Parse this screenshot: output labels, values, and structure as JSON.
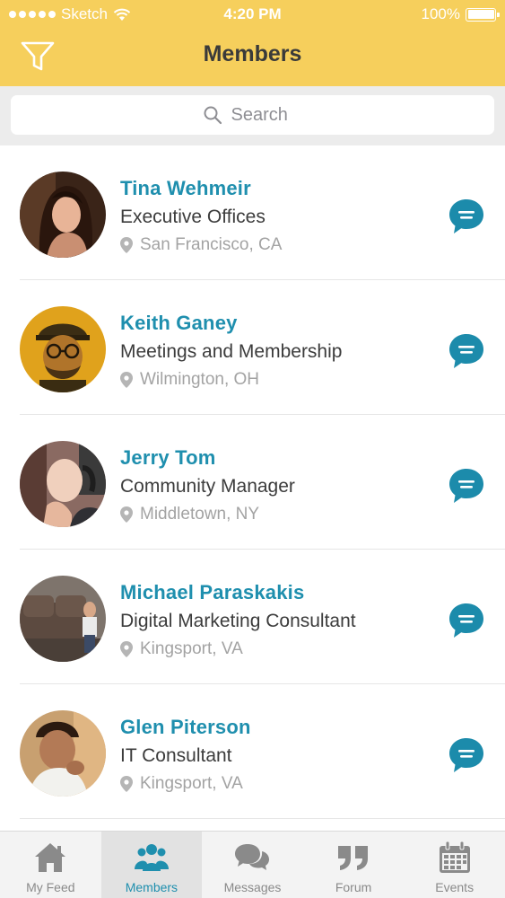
{
  "status_bar": {
    "carrier": "Sketch",
    "time": "4:20 PM",
    "battery": "100%"
  },
  "header": {
    "title": "Members"
  },
  "search": {
    "placeholder": "Search"
  },
  "members": [
    {
      "name": "Tina Wehmeir",
      "department": "Executive Offices",
      "location": "San Francisco, CA"
    },
    {
      "name": "Keith Ganey",
      "department": "Meetings and Membership",
      "location": "Wilmington, OH"
    },
    {
      "name": "Jerry Tom",
      "department": "Community Manager",
      "location": "Middletown, NY"
    },
    {
      "name": "Michael Paraskakis",
      "department": "Digital Marketing Consultant",
      "location": "Kingsport, VA"
    },
    {
      "name": "Glen Piterson",
      "department": "IT Consultant",
      "location": "Kingsport, VA"
    }
  ],
  "tabs": [
    {
      "label": "My Feed",
      "icon": "home-icon"
    },
    {
      "label": "Members",
      "icon": "members-icon",
      "active": true
    },
    {
      "label": "Messages",
      "icon": "chat-bubbles-icon"
    },
    {
      "label": "Forum",
      "icon": "quote-icon"
    },
    {
      "label": "Events",
      "icon": "calendar-icon"
    }
  ],
  "colors": {
    "header": "#f6cf5c",
    "accent": "#1f8fae",
    "chat_button": "#1c8bab"
  }
}
